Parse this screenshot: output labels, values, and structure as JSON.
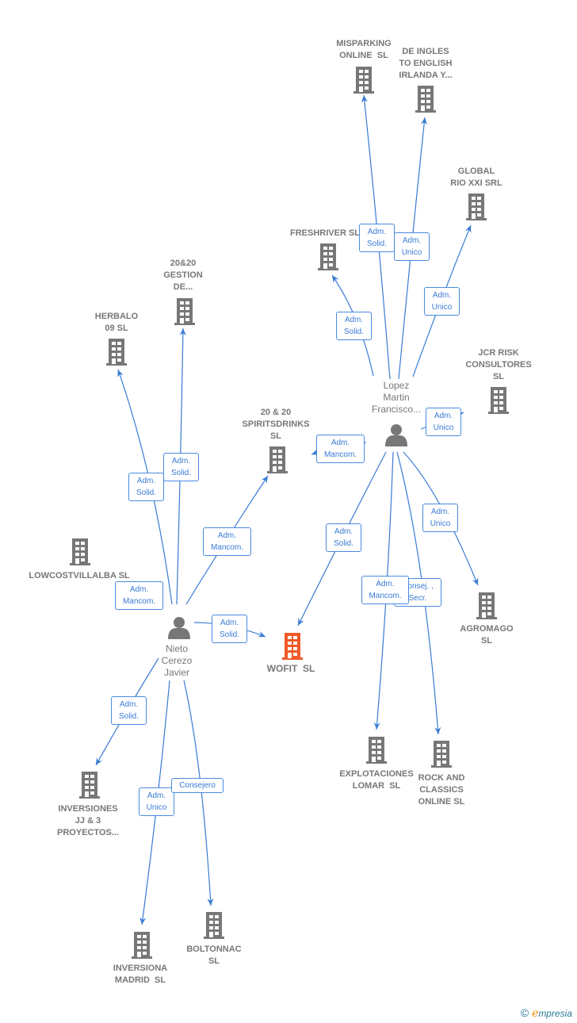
{
  "colors": {
    "edge": "#3a7bd5",
    "node": "#777777",
    "focus": "#f05a28"
  },
  "nodes": [
    {
      "id": "misparking",
      "type": "company",
      "label": "MISPARKING\nONLINE  SL"
    },
    {
      "id": "deingles",
      "type": "company",
      "label": "DE INGLES\nTO ENGLISH\nIRLANDA Y..."
    },
    {
      "id": "global",
      "type": "company",
      "label": "GLOBAL\nRIO XXI SRL"
    },
    {
      "id": "freshriver",
      "type": "company",
      "label": "FRESHRIVER SL"
    },
    {
      "id": "jcr",
      "type": "company",
      "label": "JCR RISK\nCONSULTORES\nSL"
    },
    {
      "id": "gestion",
      "type": "company",
      "label": "20&20\nGESTION\nDE..."
    },
    {
      "id": "herbalo",
      "type": "company",
      "label": "HERBALO\n09 SL"
    },
    {
      "id": "spirits",
      "type": "company",
      "label": "20 & 20\nSPIRITSDRINKS\nSL"
    },
    {
      "id": "lowcost",
      "type": "company",
      "label": "LOWCOSTVILLALBA SL"
    },
    {
      "id": "lopez",
      "type": "person",
      "label": "Lopez\nMartin\nFrancisco..."
    },
    {
      "id": "nieto",
      "type": "person",
      "label": "Nieto\nCerezo\nJavier"
    },
    {
      "id": "wofit",
      "type": "focus",
      "label": "WOFIT  SL"
    },
    {
      "id": "agromago",
      "type": "company",
      "label": "AGROMAGO\nSL"
    },
    {
      "id": "explotaciones",
      "type": "company",
      "label": "EXPLOTACIONES\nLOMAR  SL"
    },
    {
      "id": "rock",
      "type": "company",
      "label": "ROCK AND\nCLASSICS\nONLINE SL"
    },
    {
      "id": "inversionesjj",
      "type": "company",
      "label": "INVERSIONES\nJJ & 3\nPROYECTOS..."
    },
    {
      "id": "inversiona",
      "type": "company",
      "label": "INVERSIONA\nMADRID  SL"
    },
    {
      "id": "boltonnac",
      "type": "company",
      "label": "BOLTONNAC\nSL"
    }
  ],
  "edges": [
    {
      "from": "lopez",
      "to": "misparking",
      "label": "Adm.\nSolid."
    },
    {
      "from": "lopez",
      "to": "deingles",
      "label": "Adm.\nUnico"
    },
    {
      "from": "lopez",
      "to": "global",
      "label": "Adm.\nUnico"
    },
    {
      "from": "lopez",
      "to": "freshriver",
      "label": "Adm.\nSolid."
    },
    {
      "from": "lopez",
      "to": "jcr",
      "label": "Adm.\nUnico"
    },
    {
      "from": "lopez",
      "to": "spirits",
      "label": "Adm.\nMancom."
    },
    {
      "from": "lopez",
      "to": "agromago",
      "label": "Adm.\nUnico"
    },
    {
      "from": "lopez",
      "to": "wofit",
      "label": "Adm.\nSolid."
    },
    {
      "from": "lopez",
      "to": "rock",
      "label": "Consej. ,\nSecr."
    },
    {
      "from": "lopez",
      "to": "explotaciones",
      "label": "Adm.\nMancom."
    },
    {
      "from": "nieto",
      "to": "gestion",
      "label": "Adm.\nSolid."
    },
    {
      "from": "nieto",
      "to": "herbalo",
      "label": "Adm.\nSolid."
    },
    {
      "from": "nieto",
      "to": "spirits",
      "label": "Adm.\nMancom."
    },
    {
      "from": "nieto",
      "to": "lowcost",
      "label": "Adm.\nMancom."
    },
    {
      "from": "nieto",
      "to": "wofit",
      "label": "Adm.\nSolid."
    },
    {
      "from": "nieto",
      "to": "inversionesjj",
      "label": "Adm.\nSolid."
    },
    {
      "from": "nieto",
      "to": "inversiona",
      "label": "Adm.\nUnico"
    },
    {
      "from": "nieto",
      "to": "boltonnac",
      "label": "Consejero"
    }
  ],
  "footer": {
    "copyright": "©",
    "brand_e": "e",
    "brand_rest": "mpresia"
  }
}
